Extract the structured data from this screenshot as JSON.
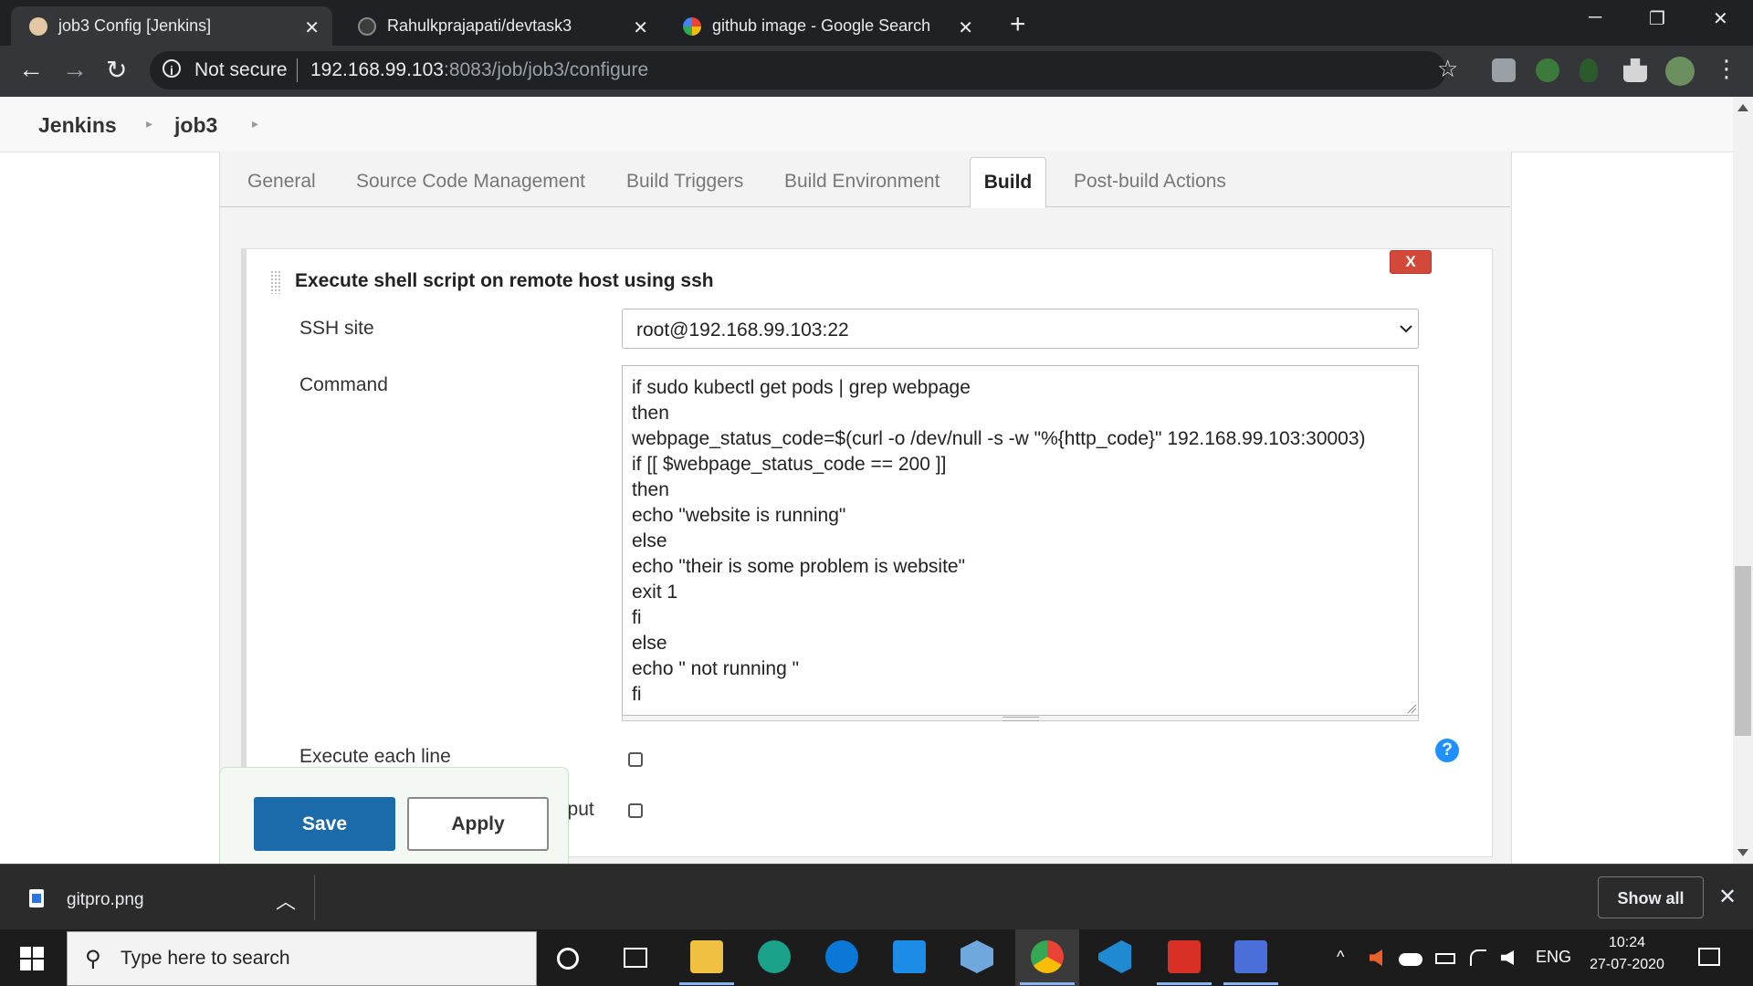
{
  "browser": {
    "tabs": [
      {
        "title": "job3 Config [Jenkins]",
        "close": "✕"
      },
      {
        "title": "Rahulkprajapati/devtask3",
        "close": "✕"
      },
      {
        "title": "github image - Google Search",
        "close": "✕"
      }
    ],
    "new_tab": "+",
    "window_controls": {
      "minimize": "─",
      "maximize": "❐",
      "close": "✕"
    },
    "nav": {
      "back": "←",
      "forward": "→",
      "reload": "↻"
    },
    "security_label": "Not secure",
    "security_icon": "i",
    "url_host": "192.168.99.103",
    "url_path": ":8083/job/job3/configure",
    "star": "☆",
    "menu": "⋮"
  },
  "breadcrumb": {
    "root": "Jenkins",
    "job": "job3",
    "sep": "▸"
  },
  "config_tabs": [
    "General",
    "Source Code Management",
    "Build Triggers",
    "Build Environment",
    "Build",
    "Post-build Actions"
  ],
  "active_tab": "Build",
  "build_step": {
    "title": "Execute shell script on remote host using ssh",
    "delete_label": "X",
    "ssh_label": "SSH site",
    "ssh_value": "root@192.168.99.103:22",
    "command_label": "Command",
    "command_lines": [
      "if sudo kubectl get pods | grep webpage",
      "then",
      "webpage_status_code=$(curl -o /dev/null -s -w \"%{http_code}\" 192.168.99.103:30003)",
      "if [[ $webpage_status_code == 200 ]]",
      "then",
      "echo \"website is running\"",
      "else",
      "echo \"their is some problem is website\"",
      "exit 1",
      "fi",
      "else",
      "echo \" not running \"",
      "fi"
    ],
    "execute_each_line_label": "Execute each line",
    "partial_label": "utput",
    "help": "?"
  },
  "actions": {
    "save": "Save",
    "apply": "Apply"
  },
  "downloads": {
    "file": "gitpro.png",
    "chevron": "︿",
    "show_all": "Show all",
    "close": "✕"
  },
  "taskbar": {
    "search_placeholder": "Type here to search",
    "search_icon": "⚲",
    "tray_chevron": "^",
    "language": "ENG",
    "time": "10:24",
    "date": "27-07-2020"
  }
}
